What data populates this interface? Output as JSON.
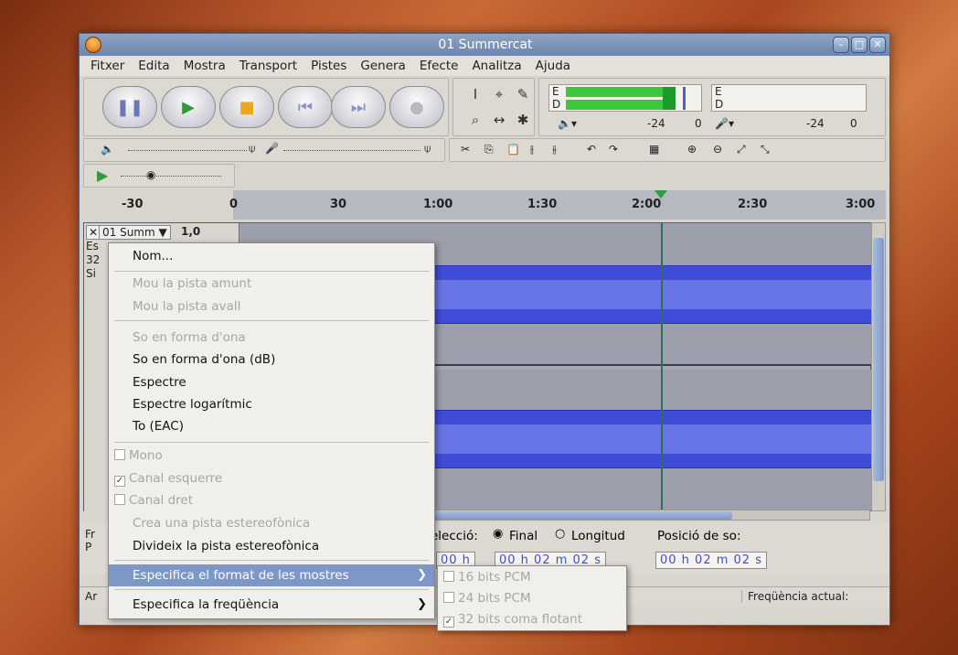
{
  "window": {
    "title": "01 Summercat"
  },
  "menubar": [
    "Fitxer",
    "Edita",
    "Mostra",
    "Transport",
    "Pistes",
    "Genera",
    "Efecte",
    "Analitza",
    "Ajuda"
  ],
  "meters": {
    "play_labels": [
      "E",
      "D"
    ],
    "rec_labels": [
      "E",
      "D"
    ],
    "scale_left": "-24",
    "scale_zero": "0",
    "scale_right": "-24",
    "scale_right_zero": "0"
  },
  "ruler": {
    "ticks": [
      "-30",
      "0",
      "30",
      "1:00",
      "1:30",
      "2:00",
      "2:30",
      "3:00"
    ]
  },
  "track": {
    "name": "01 Summ ▼",
    "gain": "1,0",
    "info1": "Es",
    "info2": "32",
    "info3": "Si"
  },
  "selection": {
    "label_sel": "elecció:",
    "opt_end": "Final",
    "opt_len": "Longitud",
    "label_pos": "Posició de so:",
    "time1": "00 h 02 m 02 s",
    "time_sel_a": "00 h 02 m 02 s",
    "time_pos": "00 h 02 m 02 s",
    "left_frag1": "Fr",
    "left_frag2": "P"
  },
  "status": {
    "left": "Ar",
    "right": "Freqüència actual: "
  },
  "context_menu": {
    "items": [
      {
        "label": "Nom...",
        "enabled": true
      },
      {
        "label": "Mou la pista amunt",
        "enabled": false
      },
      {
        "label": "Mou la pista avall",
        "enabled": false
      },
      {
        "label": "So en forma d'ona",
        "enabled": false
      },
      {
        "label": "So en forma d'ona (dB)",
        "enabled": true
      },
      {
        "label": "Espectre",
        "enabled": true
      },
      {
        "label": "Espectre logarítmic",
        "enabled": true
      },
      {
        "label": "To (EAC)",
        "enabled": true
      },
      {
        "label": "Mono",
        "enabled": false,
        "checked": false
      },
      {
        "label": "Canal esquerre",
        "enabled": false,
        "checked": true
      },
      {
        "label": "Canal dret",
        "enabled": false,
        "checked": false
      },
      {
        "label": "Crea una pista estereofònica",
        "enabled": false
      },
      {
        "label": "Divideix la pista estereofònica",
        "enabled": true
      },
      {
        "label": "Especifica el format de les mostres",
        "enabled": true,
        "highlighted": true
      },
      {
        "label": "Especifica la freqüència",
        "enabled": true
      }
    ]
  },
  "submenu": {
    "items": [
      {
        "label": "16 bits PCM",
        "checked": false
      },
      {
        "label": "24 bits PCM",
        "checked": false
      },
      {
        "label": "32 bits coma flotant",
        "checked": true
      }
    ]
  },
  "colors": {
    "accent": "#7d97c6",
    "waveform": "#3f4cd8",
    "titlebar": "#6c85ac"
  }
}
